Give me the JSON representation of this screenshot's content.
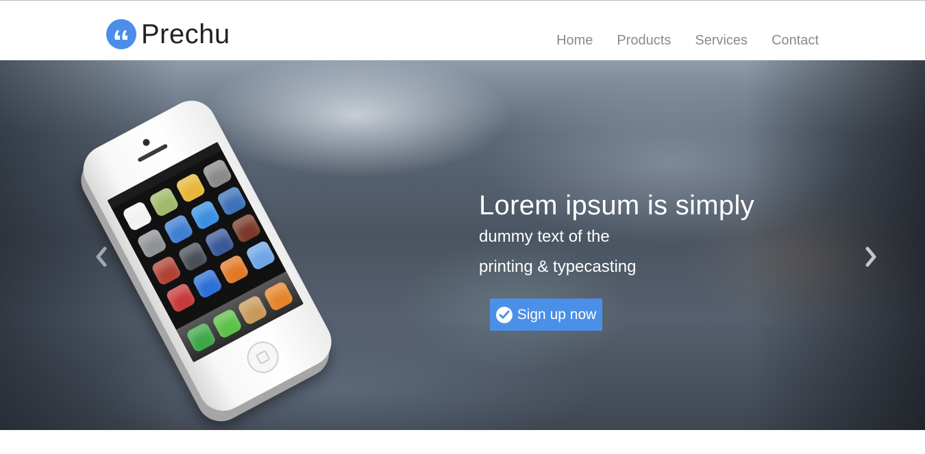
{
  "brand": {
    "name": "Prechu",
    "logo_icon": "quote-icon",
    "accent": "#4a8eea"
  },
  "nav": {
    "items": [
      {
        "label": "Home"
      },
      {
        "label": "Products"
      },
      {
        "label": "Services"
      },
      {
        "label": "Contact"
      }
    ]
  },
  "hero": {
    "title": "Lorem ipsum is simply",
    "line1": "dummy text of the",
    "line2": "printing & typecasting",
    "cta_label": "Sign up now",
    "cta_icon": "check-circle-icon",
    "cta_color": "#4a90e8",
    "prev_icon": "chevron-left-icon",
    "next_icon": "chevron-right-icon"
  }
}
